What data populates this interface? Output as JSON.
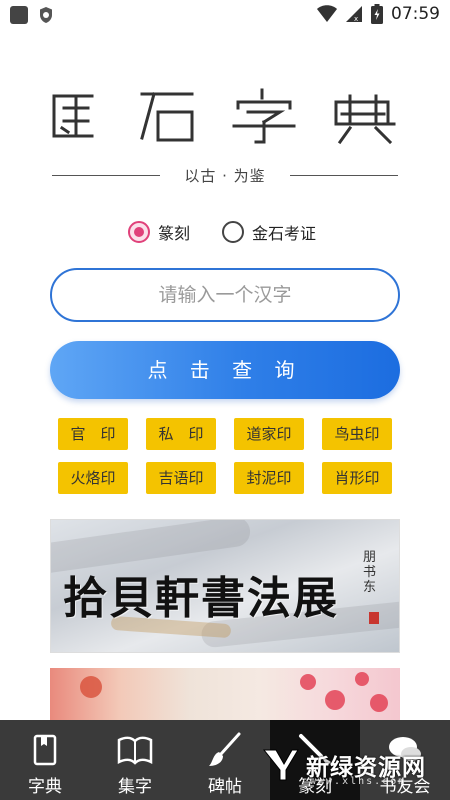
{
  "status_bar": {
    "time": "07:59"
  },
  "logo": {
    "title": "金石字典",
    "subtitle": "以古 · 为鉴"
  },
  "search_mode": {
    "options": [
      {
        "label": "篆刻",
        "selected": true
      },
      {
        "label": "金石考证",
        "selected": false
      }
    ]
  },
  "search": {
    "placeholder": "请输入一个汉字",
    "value": ""
  },
  "query_button": {
    "label": "点 击 查 询"
  },
  "categories": [
    "官　印",
    "私　印",
    "道家印",
    "鸟虫印",
    "火烙印",
    "吉语印",
    "封泥印",
    "肖形印"
  ],
  "banner1": {
    "title": "拾貝軒書法展",
    "side_text": "朋书东"
  },
  "bottom_nav": {
    "items": [
      {
        "label": "字典",
        "icon": "book-icon",
        "active": false
      },
      {
        "label": "集字",
        "icon": "open-book-icon",
        "active": false
      },
      {
        "label": "碑帖",
        "icon": "brush-icon",
        "active": false
      },
      {
        "label": "篆刻",
        "icon": "carving-knife-icon",
        "active": true
      },
      {
        "label": "书友会",
        "icon": "chat-bubbles-icon",
        "active": false
      }
    ]
  },
  "watermark": {
    "text": "新绿资源网",
    "sub": "www.xlhs.com"
  },
  "colors": {
    "accent_blue": "#2f74d6",
    "radio_pink": "#e0417a",
    "category_yellow": "#f4c300",
    "nav_bg": "#3a3a3a"
  }
}
